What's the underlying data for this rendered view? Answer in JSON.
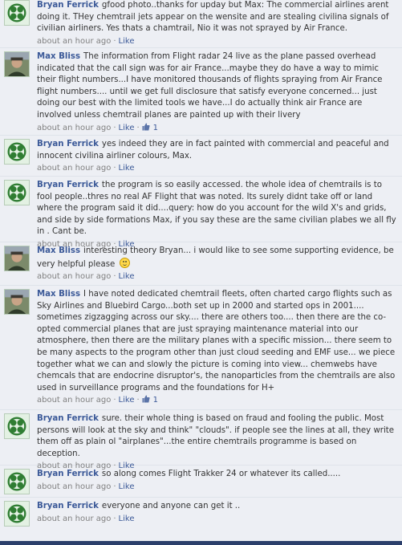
{
  "comments": [
    {
      "author": "Bryan Ferrick",
      "avatar": "celtic-logo-icon",
      "text": "gfood photo..thanks for upday but Max: The commercial airlines arent doing it. THey chemtrail jets appear on the wensite and are stealing civilina signals of civilian airliners. Yes thats a chamtrail, Nio it was not sprayed by Air France.",
      "time": "about an hour ago",
      "like_label": "Like"
    },
    {
      "author": "Max Bliss",
      "avatar": "profile-photo",
      "text": "The information from Flight radar 24 live as the plane passed overhead indicated that the call sign was for air France...maybe they do have a way to mimic their flight numbers...I have monitored thousands of flights spraying from Air France flight numbers.... until we get full disclosure that satisfy everyone concerned... just doing our best with the limited tools we have...I do actually think air France are involved unless chemtrail planes are painted up with their livery",
      "time": "about an hour ago",
      "like_label": "Like",
      "likes": "1"
    },
    {
      "author": "Bryan Ferrick",
      "avatar": "celtic-logo-icon",
      "text": "yes indeed they are in fact painted with commercial and peaceful and innocent civilina airliner colours, Max.",
      "time": "about an hour ago",
      "like_label": "Like"
    },
    {
      "author": "Bryan Ferrick",
      "avatar": "celtic-logo-icon",
      "text": "the program is so easily accessed. the whole idea of chemtrails is to fool people..thres no real AF Flight that was noted. Its surely didnt take off or land where the program said it did....query: how do you account for the wild X's and grids, and side by side formations Max, if you say these are the same civilian plabes we all fly in . Cant be.",
      "time": "about an hour ago",
      "like_label": "Like"
    },
    {
      "author": "Max Bliss",
      "avatar": "profile-photo",
      "text": "interesting theory Bryan... i would like to see some supporting evidence, be very helpful please",
      "smiley": "smiley-icon",
      "time": "about an hour ago",
      "like_label": "Like"
    },
    {
      "author": "Max Bliss",
      "avatar": "profile-photo",
      "text": "I have noted dedicated chemtrail fleets, often charted cargo flights such as Sky Airlines and Bluebird Cargo...both set up in 2000 and started ops in 2001.... sometimes zigzagging across our sky.... there are others too.... then there are the co-opted commercial planes that are just spraying maintenance material into our atmosphere, then there are the military planes with a specific mission... there seem to be many aspects to the program other than just cloud seeding and EMF use... we piece together what we can and slowly the picture is coming into view... chemwebs have chemcals that are endocrine disruptor's, the nanoparticles from the chemtrails are also used in surveillance programs and the foundations for H+",
      "time": "about an hour ago",
      "like_label": "Like",
      "likes": "1"
    },
    {
      "author": "Bryan Ferrick",
      "avatar": "celtic-logo-icon",
      "text": "sure. their whole thing is based on fraud and fooling the public. Most persons will look at the sky and think\" \"clouds\". if people see the lines at all, they write them off as plain ol \"airplanes\"...the entire chemtrails programme is based on deception.",
      "time": "about an hour ago",
      "like_label": "Like"
    },
    {
      "author": "Bryan Ferrick",
      "avatar": "celtic-logo-icon",
      "text": "so along comes Flight Trakker 24 or whatever its called.....",
      "time": "about an hour ago",
      "like_label": "Like"
    },
    {
      "author": "Bryan Ferrick",
      "avatar": "celtic-logo-icon",
      "text": "everyone and anyone can get it ..",
      "time": "about an hour ago",
      "like_label": "Like"
    }
  ],
  "colors": {
    "link": "#3b5998",
    "background": "#edeff4",
    "text": "#333333"
  }
}
